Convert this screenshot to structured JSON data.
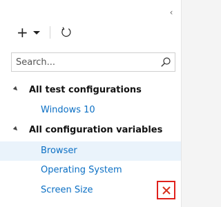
{
  "toolbar": {
    "add_icon": "plus-icon",
    "dropdown_icon": "caret-down-icon",
    "refresh_icon": "refresh-icon"
  },
  "panel": {
    "collapse_icon": "chevron-left-icon",
    "collapse_glyph": "‹"
  },
  "search": {
    "placeholder": "Search...",
    "value": "",
    "icon": "search-icon"
  },
  "tree": {
    "groups": [
      {
        "label": "All test configurations",
        "items": [
          {
            "label": "Windows 10"
          }
        ]
      },
      {
        "label": "All configuration variables",
        "items": [
          {
            "label": "Browser",
            "selected": true
          },
          {
            "label": "Operating System"
          },
          {
            "label": "Screen Size"
          }
        ]
      }
    ]
  },
  "actions": {
    "delete_icon": "close-icon",
    "delete_color": "#d7321f",
    "highlight_color": "#e0201b"
  },
  "colors": {
    "link": "#0b6fc4",
    "selected_bg": "#eaf3fb"
  }
}
